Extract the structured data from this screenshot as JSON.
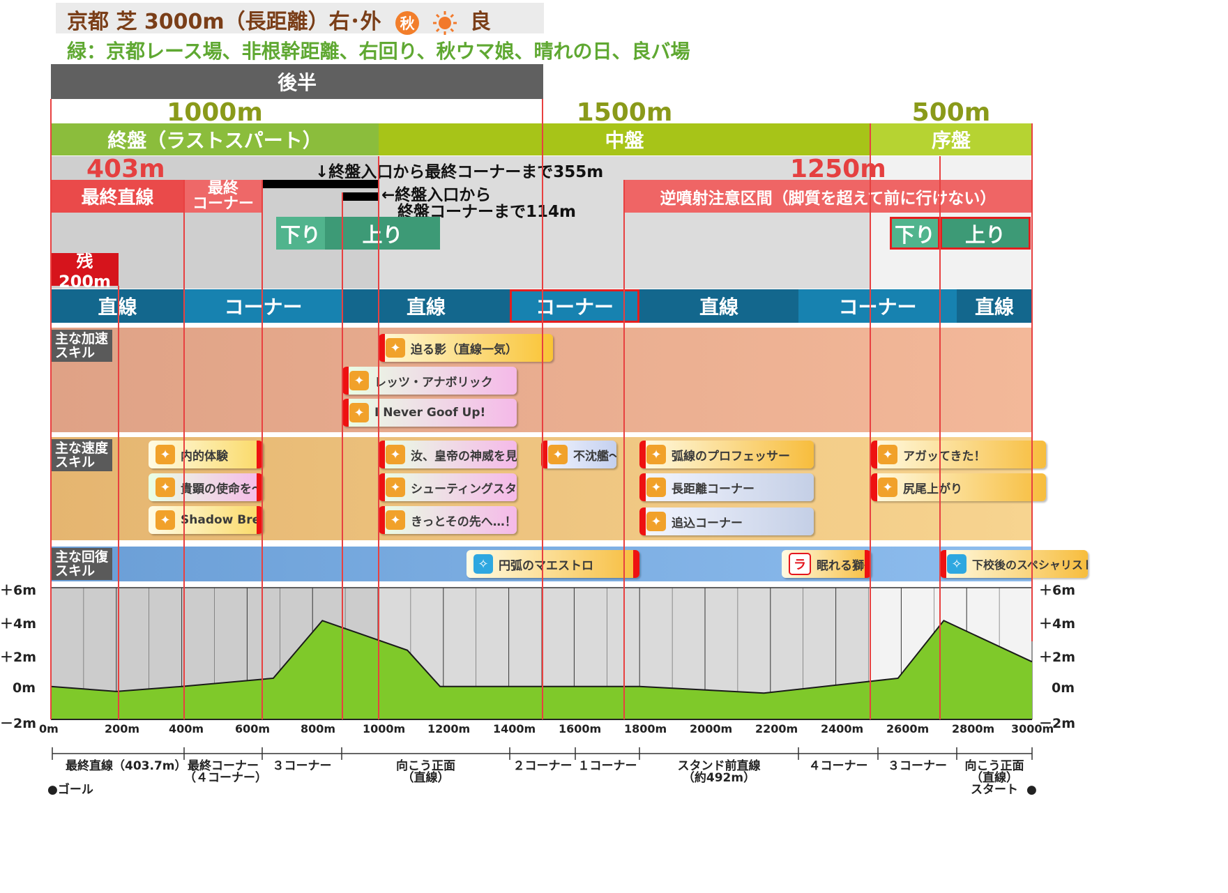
{
  "header": {
    "title": "京都 芝 3000m（長距離）右･外",
    "season_badge": "秋",
    "condition": "良",
    "subtitle": "緑：京都レース場、非根幹距離、右回り、秋ウマ娘、晴れの日、良バ場"
  },
  "half": {
    "label": "後半"
  },
  "distances": {
    "late": "1000m",
    "mid": "1500m",
    "early": "500m"
  },
  "phases": {
    "late": "終盤（ラストスパート）",
    "mid": "中盤",
    "early": "序盤"
  },
  "markers": {
    "straight_len": "403m",
    "spurt_len": "1250m",
    "remaining": "残200m"
  },
  "sections": {
    "final_straight": "最終直線",
    "final_corner": "最終\nコーナー",
    "reverse_zone": "逆噴射注意区間（脚質を超えて前に行けない）"
  },
  "notes": {
    "to_final_corner": "↓終盤入口から最終コーナーまで355m",
    "to_late_corner": "←終盤入口から\n　終盤コーナーまで114m"
  },
  "slopes": {
    "down": "下り",
    "up": "上り"
  },
  "corners": [
    "直線",
    "コーナー",
    "直線",
    "コーナー",
    "直線",
    "コーナー",
    "直線"
  ],
  "categories": {
    "accel": "主な加速\nスキル",
    "speed": "主な速度\nスキル",
    "recovery": "主な回復\nスキル"
  },
  "skills": {
    "accel": [
      "迫る影（直線一気）",
      "レッツ・アナボリック",
      "I Never Goof Up!"
    ],
    "speed": [
      "内的体験",
      "貴顕の使命を～",
      "Shadow Break",
      "汝、皇帝の神威を見よ",
      "シューティングスター",
      "きっとその先へ…！",
      "不沈艦～",
      "弧線のプロフェッサー",
      "長距離コーナー",
      "追込コーナー",
      "アガッてきた！",
      "尻尾上がり"
    ],
    "recovery": [
      "円弧のマエストロ",
      "眠れる獅子",
      "下校後のスペシャリスト"
    ],
    "icon_glyph": "✦",
    "icon_glyph_blue": "✧",
    "icon_glyph_ra": "ラ"
  },
  "elevation": {
    "y_ticks": [
      "＋6m",
      "＋4m",
      "＋2m",
      "0m",
      "－2m"
    ],
    "x_ticks": [
      "0m",
      "200m",
      "400m",
      "600m",
      "800m",
      "1000m",
      "1200m",
      "1400m",
      "1600m",
      "1800m",
      "2000m",
      "2200m",
      "2400m",
      "2600m",
      "2800m",
      "3000m"
    ],
    "profile": [
      [
        0,
        0
      ],
      [
        200,
        -0.3
      ],
      [
        400,
        0
      ],
      [
        680,
        0.5
      ],
      [
        830,
        4
      ],
      [
        1090,
        2.2
      ],
      [
        1190,
        0
      ],
      [
        1800,
        0
      ],
      [
        2180,
        -0.4
      ],
      [
        2500,
        0.3
      ],
      [
        2590,
        0.5
      ],
      [
        2730,
        4
      ],
      [
        3000,
        1.5
      ]
    ]
  },
  "bottom": {
    "labels": [
      "最終直線（403.7m）",
      "最終コーナー\n（４コーナー）",
      "３コーナー",
      "向こう正面\n（直線）",
      "２コーナー",
      "１コーナー",
      "スタンド前直線\n（約492m）",
      "４コーナー",
      "３コーナー",
      "向こう正面\n（直線）\nスタート"
    ],
    "goal": "●ゴール",
    "start_dot": "●"
  }
}
